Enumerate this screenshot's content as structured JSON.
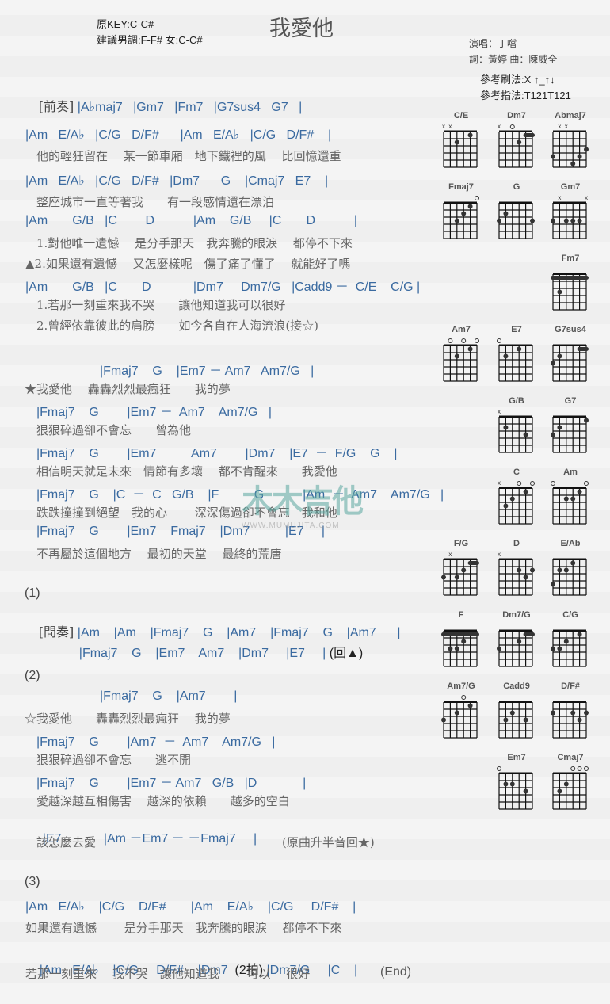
{
  "header": {
    "title": "我愛他",
    "original_key": "原KEY:C-C#",
    "suggested_key": "建議男調:F-F# 女:C-C#",
    "singer": "演唱：丁噹",
    "writers": "詞：黃婷   曲：陳威全",
    "strum_pattern": "參考刷法:X ↑_↑↓",
    "finger_pattern": "參考指法:T121T121"
  },
  "watermark": {
    "text": "木木吉他",
    "url_text": "WWW.MUMUJITA.COM"
  },
  "sheet": {
    "intro": {
      "label": "[前奏]",
      "chords": "|A♭maj7   |Gm7   |Fm7   |G7sus4   G7   |"
    },
    "v1c1": "|Am   E/A♭   |C/G   D/F#      |Am   E/A♭   |C/G   D/F#    |",
    "v1l1": "他的輕狂留在　 某一節車廂　地下鐵裡的風　 比回憶還重",
    "v1c2": "|Am   E/A♭   |C/G   D/F#   |Dm7      G    |Cmaj7   E7    |",
    "v1l2": "整座城市一直等著我　　有一段感情還在漂泊",
    "v1c3": "|Am       G/B   |C        D           |Am    G/B     |C       D           |",
    "v1l3": "1.對他唯一遺憾　 是分手那天　我奔騰的眼淚　 都停不下來",
    "v1l4": "▲2.如果還有遺憾　 又怎麼樣呢　傷了痛了懂了　 就能好了嗎",
    "v1c4": "|Am       G/B   |C       D            |Dm7     Dm7/G   |Cadd9 －  C/E    C/G |",
    "v1l5": "1.若那一刻重來我不哭　　讓他知道我可以很好",
    "v1l6": "2.曾經依靠彼此的肩膀　　如今各自在人海流浪(接☆)",
    "ch1c1": "|Fmaj7    G    |Em7 － Am7   Am7/G   |",
    "ch1l1": "★我愛他　 轟轟烈烈最瘋狂　　我的夢",
    "ch1c2": "|Fmaj7    G        |Em7 －  Am7    Am7/G   |",
    "ch1l2": "狠狠碎過卻不會忘　　曾為他",
    "ch1c3": "|Fmaj7    G        |Em7          Am7        |Dm7    |E7  －  F/G    G    |",
    "ch1l3": "相信明天就是未來　情節有多壞　 都不肯醒來　　我愛他",
    "ch1c4": "|Fmaj7    G    |C  －  C   G/B    |F          G           |Am  －  Am7    Am7/G   |",
    "ch1l4": "跌跌撞撞到絕望　我的心　　 深深傷過卻不會忘　我和他",
    "ch1c5": "|Fmaj7    G        |Em7    Fmaj7    |Dm7          |E7     |",
    "ch1l5": "不再屬於這個地方　 最初的天堂　 最終的荒唐",
    "sec1": "(1)",
    "inter": {
      "label": "[間奏]",
      "chords1": "|Am    |Am    |Fmaj7    G    |Am7    |Fmaj7    G    |Am7      |",
      "chords2": "|Fmaj7    G    |Em7    Am7    |Dm7     |E7     |",
      "back": "(回▲)"
    },
    "sec2": "(2)",
    "ch2c1": "|Fmaj7    G    |Am7        |",
    "ch2l1": "☆我愛他　　轟轟烈烈最瘋狂　 我的夢",
    "ch2c2": "|Fmaj7    G        |Am7  －  Am7    Am7/G   |",
    "ch2l2": "狠狠碎過卻不會忘　　逃不開",
    "ch2c3": "|Fmaj7    G        |Em7 － Am7   G/B   |D             |",
    "ch2l3": "愛越深越互相傷害　 越深的依賴　　越多的空白",
    "ch2c4a": "|E7            |Am ",
    "ch2c4b": "－Em7",
    "ch2c4c": " － ",
    "ch2c4d": "－Fmaj7",
    "ch2c4e": "     |",
    "ch2l4": "該怎麼去愛",
    "ch2note": "(原曲升半音回★)",
    "sec3": "(3)",
    "o1c": "|Am   E/A♭    |C/G    D/F#       |Am    E/A♭    |C/G     D/F#    |",
    "o1l": "如果還有遺憾　　 是分手那天　我奔騰的眼淚　 都停不下來",
    "o2c_a": "|Am   E/A♭    |C/G     D/F#    |Dm7  ",
    "o2c_beat": "(2拍)",
    "o2c_b": " |Dm7/G     |C    |",
    "o2l": "若那一刻重來　 我不哭　讓他知道我　　 可以　 很好",
    "o2end": "(End)"
  },
  "chord_charts": [
    {
      "name": "C/E"
    },
    {
      "name": "Dm7"
    },
    {
      "name": "Abmaj7"
    },
    {
      "name": "Fmaj7"
    },
    {
      "name": "G"
    },
    {
      "name": "Gm7"
    },
    {
      "name": "Fm7"
    },
    {
      "name": "Am7"
    },
    {
      "name": "E7"
    },
    {
      "name": "G7sus4"
    },
    {
      "name": "G/B"
    },
    {
      "name": "G7"
    },
    {
      "name": "C"
    },
    {
      "name": "Am"
    },
    {
      "name": "F/G"
    },
    {
      "name": "D"
    },
    {
      "name": "E/Ab"
    },
    {
      "name": "F"
    },
    {
      "name": "Dm7/G"
    },
    {
      "name": "C/G"
    },
    {
      "name": "Am7/G"
    },
    {
      "name": "Cadd9"
    },
    {
      "name": "D/F#"
    },
    {
      "name": "Em7"
    },
    {
      "name": "Cmaj7"
    }
  ]
}
